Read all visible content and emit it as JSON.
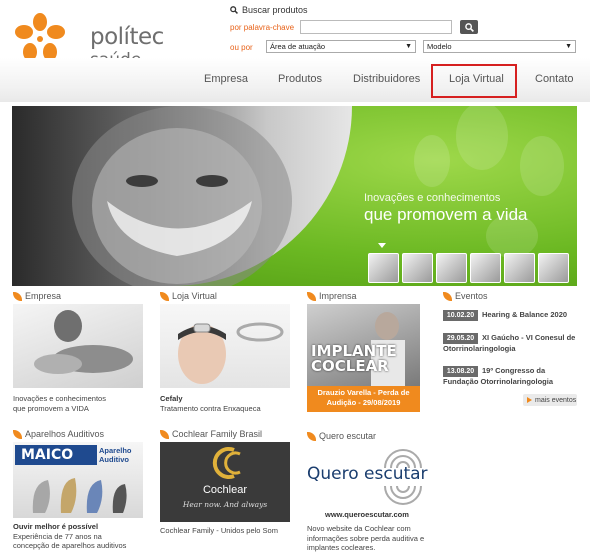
{
  "brand": {
    "name_line1": "polítec",
    "name_line2": "saúde",
    "orange": "#f08a1e",
    "green": "#6bb822"
  },
  "search": {
    "title": "Buscar produtos",
    "keyword_label": "por palavra-chave",
    "keyword_value": "",
    "or_label": "ou por",
    "area_select": "Área de atuação",
    "model_select": "Modelo"
  },
  "nav": [
    "Empresa",
    "Produtos",
    "Distribuidores",
    "Loja Virtual",
    "Contato"
  ],
  "banner": {
    "line1": "Inovações e conhecimentos",
    "line2": "que promovem a vida"
  },
  "sections": {
    "empresa": {
      "title": "Empresa",
      "caption": [
        "Inovações e conhecimentos",
        "que promovem a VIDA"
      ]
    },
    "loja": {
      "title": "Loja Virtual",
      "caption_bold": "Cefaly",
      "caption": "Tratamento contra Enxaqueca"
    },
    "imprensa": {
      "title": "Imprensa",
      "image_text": [
        "IMPLANTE",
        "COCLEAR"
      ],
      "caption": [
        "Drauzio Varella - Perda de",
        "Audição - 29/08/2019"
      ]
    },
    "eventos": {
      "title": "Eventos",
      "items": [
        {
          "date": "10.02.20",
          "text": [
            "Hearing & Balance 2020"
          ]
        },
        {
          "date": "29.05.20",
          "text": [
            "XI Gaúcho - VI Conesul de",
            "Otorrinolaringologia"
          ]
        },
        {
          "date": "13.08.20",
          "text": [
            "19º Congresso da",
            "Fundação Otorrinolaringologia"
          ]
        }
      ],
      "more": "mais eventos"
    },
    "aparelhos": {
      "title": "Aparelhos Auditivos",
      "brand": "MAICO",
      "brand_tag": [
        "Aparelho",
        "Auditivo"
      ],
      "caption_bold": "Ouvir melhor é possível",
      "caption": [
        "Experiência de 77 anos na",
        "concepção de aparelhos auditivos"
      ]
    },
    "cochlear": {
      "title": "Cochlear Family Brasil",
      "logo": "Cochlear",
      "tagline": "Hear now. And always",
      "caption": "Cochlear Family - Unidos pelo Som"
    },
    "quero": {
      "title": "Quero escutar",
      "logo": "Quero escutar",
      "url": "www.queroescutar.com",
      "caption": [
        "Novo website da Cochlear com",
        "informações sobre perda auditiva e",
        "implantes cocleares."
      ]
    }
  }
}
